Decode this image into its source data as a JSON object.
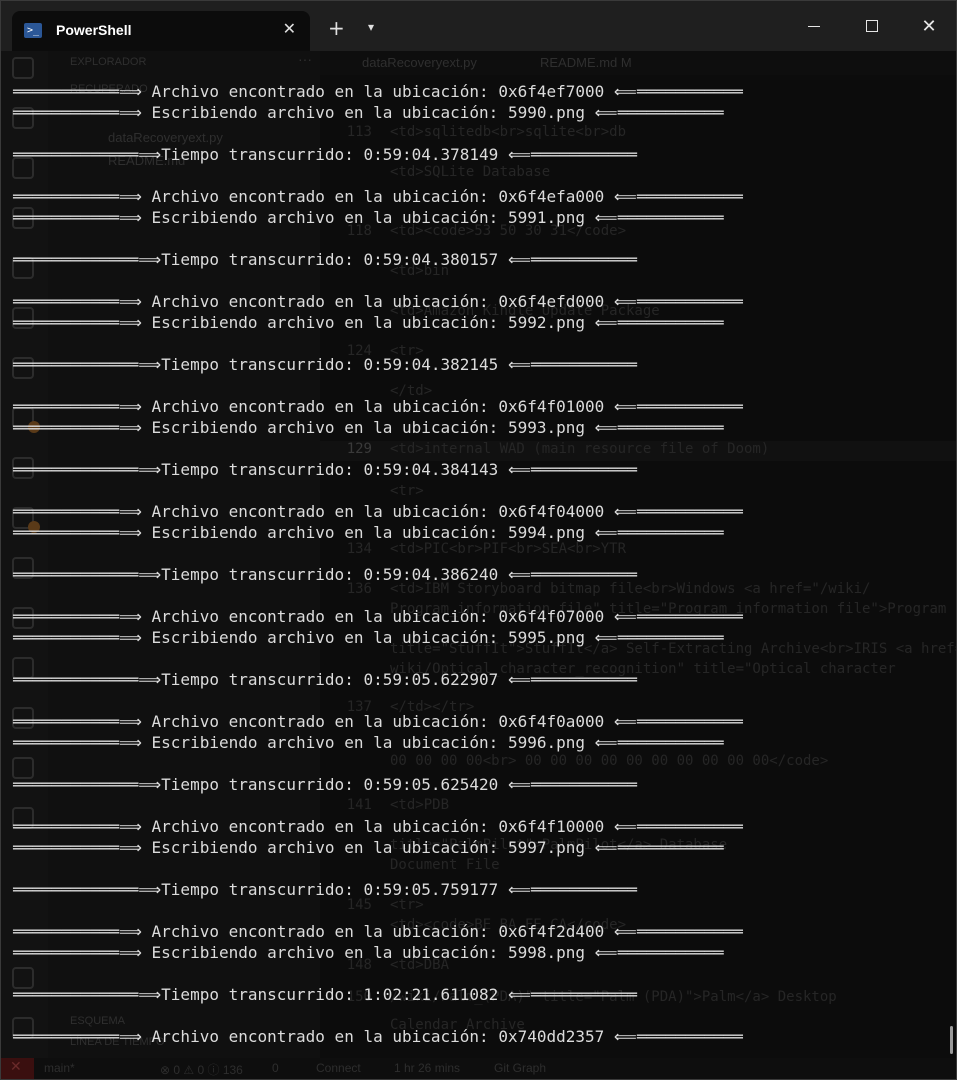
{
  "window": {
    "tab_title": "PowerShell",
    "tab_icon_glyph": ">_",
    "icons": [
      "powershell-icon",
      "close-icon",
      "plus-icon",
      "chevron-down-icon",
      "minimize-icon",
      "maximize-icon",
      "close-icon"
    ],
    "controls": {
      "new_tab": "+",
      "dropdown": "⌄",
      "close_glyph": "✕",
      "tab_close_glyph": "✕"
    }
  },
  "background_editor": {
    "explorer_title": "EXPLORADOR",
    "explorer_more": "···",
    "folder_row": "RECUPERADO",
    "files": [
      "dataRecoveryext.py",
      "README.md"
    ],
    "editor_tabs": [
      "dataRecoveryext.py",
      "README.md M"
    ],
    "outline_label": "ESQUEMA",
    "timeline_label": "LÍNEA DE TIEMPO",
    "code_lines": [
      {
        "n": "113",
        "t": "<td>sqlitedb<br>sqlite<br>db"
      },
      {
        "n": "",
        "t": "<td>SQLite Database"
      },
      {
        "n": "118",
        "t": "<td><code>53 50 30 31</code>"
      },
      {
        "n": "",
        "t": "<td>bin"
      },
      {
        "n": "",
        "t": "<td>Amazon Kindle Update Package"
      },
      {
        "n": "124",
        "t": "<tr>"
      },
      {
        "n": "",
        "t": "</td>"
      },
      {
        "n": "129",
        "t": "<td>internal WAD (main resource file of Doom)"
      },
      {
        "n": "",
        "t": "<tr>"
      },
      {
        "n": "134",
        "t": "<td>PIC<br>PIF<br>SEA<br>YTR"
      },
      {
        "n": "136",
        "t": "<td>IBM Storyboard bitmap file<br>Windows <a href=\"/wiki/"
      },
      {
        "n": "",
        "t": "Program_information_file\" title=\"Program information file\">Program"
      },
      {
        "n": "",
        "t": "title=\"StuffIt\">StuffIt</a> Self-Extracting Archive<br>IRIS <a href="
      },
      {
        "n": "",
        "t": "wiki/Optical_character_recognition\" title=\"Optical character"
      },
      {
        "n": "137",
        "t": "</td></tr>"
      },
      {
        "n": "",
        "t": "00 00 00 00<br> 00 00 00 00 00 00 00 00 00 00</code>"
      },
      {
        "n": "141",
        "t": "<td>PDB"
      },
      {
        "n": "",
        "t": "title=\"PalmPilot\">PalmPilot</a> Database"
      },
      {
        "n": "",
        "t": "Document File"
      },
      {
        "n": "145",
        "t": "<tr>"
      },
      {
        "n": "",
        "t": "<td><code>BE BA FE CA</code>"
      },
      {
        "n": "148",
        "t": "<td>DBA"
      },
      {
        "n": "150",
        "t": "/wiki/Palm_(PDA)\" title=\"Palm (PDA)\">Palm</a> Desktop"
      },
      {
        "n": "",
        "t": "Calendar Archive"
      }
    ],
    "status": {
      "branch": "main*",
      "problems": "⊗ 0 ⚠ 0 ⓘ 136",
      "ports": "0",
      "connect": "Connect",
      "time": "1 hr 26 mins",
      "git_graph": "Git Graph"
    }
  },
  "terminal": {
    "lines": [
      "═══════════⟹ Archivo encontrado en la ubicación: 0x6f4ef7000 ⟸═══════════",
      "═══════════⟹ Escribiendo archivo en la ubicación: 5990.png ⟸═══════════",
      "═════════════⟹Tiempo transcurrido: 0:59:04.378149 ⟸═══════════",
      "═══════════⟹ Archivo encontrado en la ubicación: 0x6f4efa000 ⟸═══════════",
      "═══════════⟹ Escribiendo archivo en la ubicación: 5991.png ⟸═══════════",
      "═════════════⟹Tiempo transcurrido: 0:59:04.380157 ⟸═══════════",
      "═══════════⟹ Archivo encontrado en la ubicación: 0x6f4efd000 ⟸═══════════",
      "═══════════⟹ Escribiendo archivo en la ubicación: 5992.png ⟸═══════════",
      "═════════════⟹Tiempo transcurrido: 0:59:04.382145 ⟸═══════════",
      "═══════════⟹ Archivo encontrado en la ubicación: 0x6f4f01000 ⟸═══════════",
      "═══════════⟹ Escribiendo archivo en la ubicación: 5993.png ⟸═══════════",
      "═════════════⟹Tiempo transcurrido: 0:59:04.384143 ⟸═══════════",
      "═══════════⟹ Archivo encontrado en la ubicación: 0x6f4f04000 ⟸═══════════",
      "═══════════⟹ Escribiendo archivo en la ubicación: 5994.png ⟸═══════════",
      "═════════════⟹Tiempo transcurrido: 0:59:04.386240 ⟸═══════════",
      "═══════════⟹ Archivo encontrado en la ubicación: 0x6f4f07000 ⟸═══════════",
      "═══════════⟹ Escribiendo archivo en la ubicación: 5995.png ⟸═══════════",
      "═════════════⟹Tiempo transcurrido: 0:59:05.622907 ⟸═══════════",
      "═══════════⟹ Archivo encontrado en la ubicación: 0x6f4f0a000 ⟸═══════════",
      "═══════════⟹ Escribiendo archivo en la ubicación: 5996.png ⟸═══════════",
      "═════════════⟹Tiempo transcurrido: 0:59:05.625420 ⟸═══════════",
      "═══════════⟹ Archivo encontrado en la ubicación: 0x6f4f10000 ⟸═══════════",
      "═══════════⟹ Escribiendo archivo en la ubicación: 5997.png ⟸═══════════",
      "═════════════⟹Tiempo transcurrido: 0:59:05.759177 ⟸═══════════",
      "═══════════⟹ Archivo encontrado en la ubicación: 0x6f4f2d400 ⟸═══════════",
      "═══════════⟹ Escribiendo archivo en la ubicación: 5998.png ⟸═══════════",
      "═════════════⟹Tiempo transcurrido: 1:02:21.611082 ⟸═══════════",
      "═══════════⟹ Archivo encontrado en la ubicación: 0x740dd2357 ⟸═══════════"
    ]
  },
  "colors": {
    "terminal_bg": "#0c0c0c",
    "terminal_text": "#dcdcdc",
    "titlebar_bg": "#1f1f1f"
  }
}
